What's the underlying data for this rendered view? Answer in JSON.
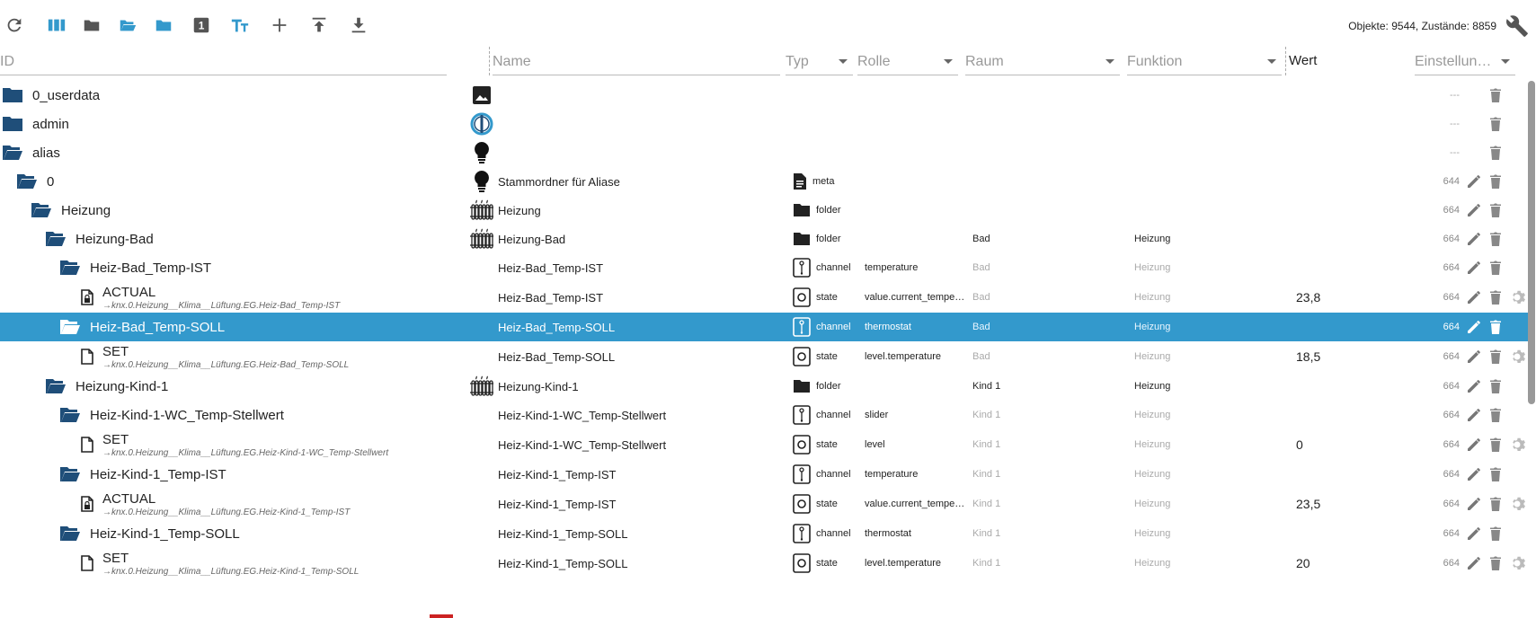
{
  "toolbar": {
    "buttons": [
      {
        "name": "refresh-icon",
        "color": "#555"
      },
      {
        "name": "columns-icon",
        "color": "#3399cc"
      },
      {
        "name": "folder-icon",
        "color": "#555"
      },
      {
        "name": "folder-open-icon",
        "color": "#3399cc"
      },
      {
        "name": "folder-closed-icon",
        "color": "#3399cc"
      },
      {
        "name": "number-one-icon",
        "color": "#555"
      },
      {
        "name": "text-size-icon",
        "color": "#3399cc"
      },
      {
        "name": "add-icon",
        "color": "#555"
      },
      {
        "name": "upload-icon",
        "color": "#555"
      },
      {
        "name": "download-icon",
        "color": "#555"
      }
    ],
    "stats": "Objekte: 9544, Zustände: 8859",
    "settings_icon": "wrench-icon"
  },
  "header": {
    "id_placeholder": "ID",
    "name_placeholder": "Name",
    "typ_label": "Typ",
    "rolle_label": "Rolle",
    "raum_label": "Raum",
    "funktion_label": "Funktion",
    "wert_label": "Wert",
    "einstellungen_label": "Einstellun…"
  },
  "colors": {
    "accent": "#3399cc",
    "folder": "#1f4e79",
    "selected_bg": "#3399cc"
  },
  "rows": [
    {
      "level": 0,
      "kind": "folder-closed",
      "id": "0_userdata",
      "alias": "",
      "obj_icon": "image-icon",
      "name": "",
      "typ_icon": "",
      "typ": "",
      "rolle": "",
      "raum": "",
      "raum_style": "",
      "funktion": "",
      "funktion_style": "",
      "wert": "",
      "acl": "---",
      "edit": false,
      "gear": false
    },
    {
      "level": 0,
      "kind": "folder-closed",
      "id": "admin",
      "alias": "",
      "obj_icon": "admin-logo-icon",
      "name": "",
      "typ_icon": "",
      "typ": "",
      "rolle": "",
      "raum": "",
      "raum_style": "",
      "funktion": "",
      "funktion_style": "",
      "wert": "",
      "acl": "---",
      "edit": false,
      "gear": false
    },
    {
      "level": 0,
      "kind": "folder-open",
      "id": "alias",
      "alias": "",
      "obj_icon": "lightbulb-icon",
      "name": "",
      "typ_icon": "",
      "typ": "",
      "rolle": "",
      "raum": "",
      "raum_style": "",
      "funktion": "",
      "funktion_style": "",
      "wert": "",
      "acl": "---",
      "edit": false,
      "gear": false
    },
    {
      "level": 1,
      "kind": "folder-open",
      "id": "0",
      "alias": "",
      "obj_icon": "lightbulb-icon",
      "name": "Stammordner für Aliase",
      "typ_icon": "meta-icon",
      "typ": "meta",
      "rolle": "",
      "raum": "",
      "raum_style": "",
      "funktion": "",
      "funktion_style": "",
      "wert": "",
      "acl": "644",
      "edit": true,
      "gear": false
    },
    {
      "level": 2,
      "kind": "folder-open",
      "id": "Heizung",
      "alias": "",
      "obj_icon": "radiator-icon",
      "name": "Heizung",
      "typ_icon": "folder-type-icon",
      "typ": "folder",
      "rolle": "",
      "raum": "",
      "raum_style": "",
      "funktion": "",
      "funktion_style": "",
      "wert": "",
      "acl": "664",
      "edit": true,
      "gear": false
    },
    {
      "level": 3,
      "kind": "folder-open",
      "id": "Heizung-Bad",
      "alias": "",
      "obj_icon": "radiator-icon",
      "name": "Heizung-Bad",
      "typ_icon": "folder-type-icon",
      "typ": "folder",
      "rolle": "",
      "raum": "Bad",
      "raum_style": "dark",
      "funktion": "Heizung",
      "funktion_style": "dark",
      "wert": "",
      "acl": "664",
      "edit": true,
      "gear": false
    },
    {
      "level": 4,
      "kind": "folder-open",
      "id": "Heiz-Bad_Temp-IST",
      "alias": "",
      "obj_icon": "",
      "name": "Heiz-Bad_Temp-IST",
      "typ_icon": "channel-icon",
      "typ": "channel",
      "rolle": "temperature",
      "raum": "Bad",
      "raum_style": "muted",
      "funktion": "Heizung",
      "funktion_style": "muted",
      "wert": "",
      "acl": "664",
      "edit": true,
      "gear": false
    },
    {
      "level": 5,
      "kind": "doc-lock",
      "id": "ACTUAL",
      "alias": "→knx.0.Heizung__Klima__Lüftung.EG.Heiz-Bad_Temp-IST",
      "obj_icon": "",
      "name": "Heiz-Bad_Temp-IST",
      "typ_icon": "state-icon",
      "typ": "state",
      "rolle": "value.current_tempe…",
      "raum": "Bad",
      "raum_style": "muted",
      "funktion": "Heizung",
      "funktion_style": "muted",
      "wert": "23,8",
      "acl": "664",
      "edit": true,
      "gear": true
    },
    {
      "level": 4,
      "kind": "folder-open",
      "id": "Heiz-Bad_Temp-SOLL",
      "alias": "",
      "obj_icon": "",
      "name": "Heiz-Bad_Temp-SOLL",
      "typ_icon": "channel-icon",
      "typ": "channel",
      "rolle": "thermostat",
      "raum": "Bad",
      "raum_style": "muted",
      "funktion": "Heizung",
      "funktion_style": "muted",
      "wert": "",
      "acl": "664",
      "edit": true,
      "gear": false,
      "selected": true
    },
    {
      "level": 5,
      "kind": "doc",
      "id": "SET",
      "alias": "→knx.0.Heizung__Klima__Lüftung.EG.Heiz-Bad_Temp-SOLL",
      "obj_icon": "",
      "name": "Heiz-Bad_Temp-SOLL",
      "typ_icon": "state-icon",
      "typ": "state",
      "rolle": "level.temperature",
      "raum": "Bad",
      "raum_style": "muted",
      "funktion": "Heizung",
      "funktion_style": "muted",
      "wert": "18,5",
      "acl": "664",
      "edit": true,
      "gear": true
    },
    {
      "level": 3,
      "kind": "folder-open",
      "id": "Heizung-Kind-1",
      "alias": "",
      "obj_icon": "radiator-icon",
      "name": "Heizung-Kind-1",
      "typ_icon": "folder-type-icon",
      "typ": "folder",
      "rolle": "",
      "raum": "Kind 1",
      "raum_style": "dark",
      "funktion": "Heizung",
      "funktion_style": "dark",
      "wert": "",
      "acl": "664",
      "edit": true,
      "gear": false
    },
    {
      "level": 4,
      "kind": "folder-open",
      "id": "Heiz-Kind-1-WC_Temp-Stellwert",
      "alias": "",
      "obj_icon": "",
      "name": "Heiz-Kind-1-WC_Temp-Stellwert",
      "typ_icon": "channel-icon",
      "typ": "channel",
      "rolle": "slider",
      "raum": "Kind 1",
      "raum_style": "muted",
      "funktion": "Heizung",
      "funktion_style": "muted",
      "wert": "",
      "acl": "664",
      "edit": true,
      "gear": false
    },
    {
      "level": 5,
      "kind": "doc",
      "id": "SET",
      "alias": "→knx.0.Heizung__Klima__Lüftung.EG.Heiz-Kind-1-WC_Temp-Stellwert",
      "obj_icon": "",
      "name": "Heiz-Kind-1-WC_Temp-Stellwert",
      "typ_icon": "state-icon",
      "typ": "state",
      "rolle": "level",
      "raum": "Kind 1",
      "raum_style": "muted",
      "funktion": "Heizung",
      "funktion_style": "muted",
      "wert": "0",
      "acl": "664",
      "edit": true,
      "gear": true
    },
    {
      "level": 4,
      "kind": "folder-open",
      "id": "Heiz-Kind-1_Temp-IST",
      "alias": "",
      "obj_icon": "",
      "name": "Heiz-Kind-1_Temp-IST",
      "typ_icon": "channel-icon",
      "typ": "channel",
      "rolle": "temperature",
      "raum": "Kind 1",
      "raum_style": "muted",
      "funktion": "Heizung",
      "funktion_style": "muted",
      "wert": "",
      "acl": "664",
      "edit": true,
      "gear": false
    },
    {
      "level": 5,
      "kind": "doc-lock",
      "id": "ACTUAL",
      "alias": "→knx.0.Heizung__Klima__Lüftung.EG.Heiz-Kind-1_Temp-IST",
      "obj_icon": "",
      "name": "Heiz-Kind-1_Temp-IST",
      "typ_icon": "state-icon",
      "typ": "state",
      "rolle": "value.current_tempe…",
      "raum": "Kind 1",
      "raum_style": "muted",
      "funktion": "Heizung",
      "funktion_style": "muted",
      "wert": "23,5",
      "acl": "664",
      "edit": true,
      "gear": true
    },
    {
      "level": 4,
      "kind": "folder-open",
      "id": "Heiz-Kind-1_Temp-SOLL",
      "alias": "",
      "obj_icon": "",
      "name": "Heiz-Kind-1_Temp-SOLL",
      "typ_icon": "channel-icon",
      "typ": "channel",
      "rolle": "thermostat",
      "raum": "Kind 1",
      "raum_style": "muted",
      "funktion": "Heizung",
      "funktion_style": "muted",
      "wert": "",
      "acl": "664",
      "edit": true,
      "gear": false
    },
    {
      "level": 5,
      "kind": "doc",
      "id": "SET",
      "alias": "→knx.0.Heizung__Klima__Lüftung.EG.Heiz-Kind-1_Temp-SOLL",
      "obj_icon": "",
      "name": "Heiz-Kind-1_Temp-SOLL",
      "typ_icon": "state-icon",
      "typ": "state",
      "rolle": "level.temperature",
      "raum": "Kind 1",
      "raum_style": "muted",
      "funktion": "Heizung",
      "funktion_style": "muted",
      "wert": "20",
      "acl": "664",
      "edit": true,
      "gear": true
    }
  ]
}
